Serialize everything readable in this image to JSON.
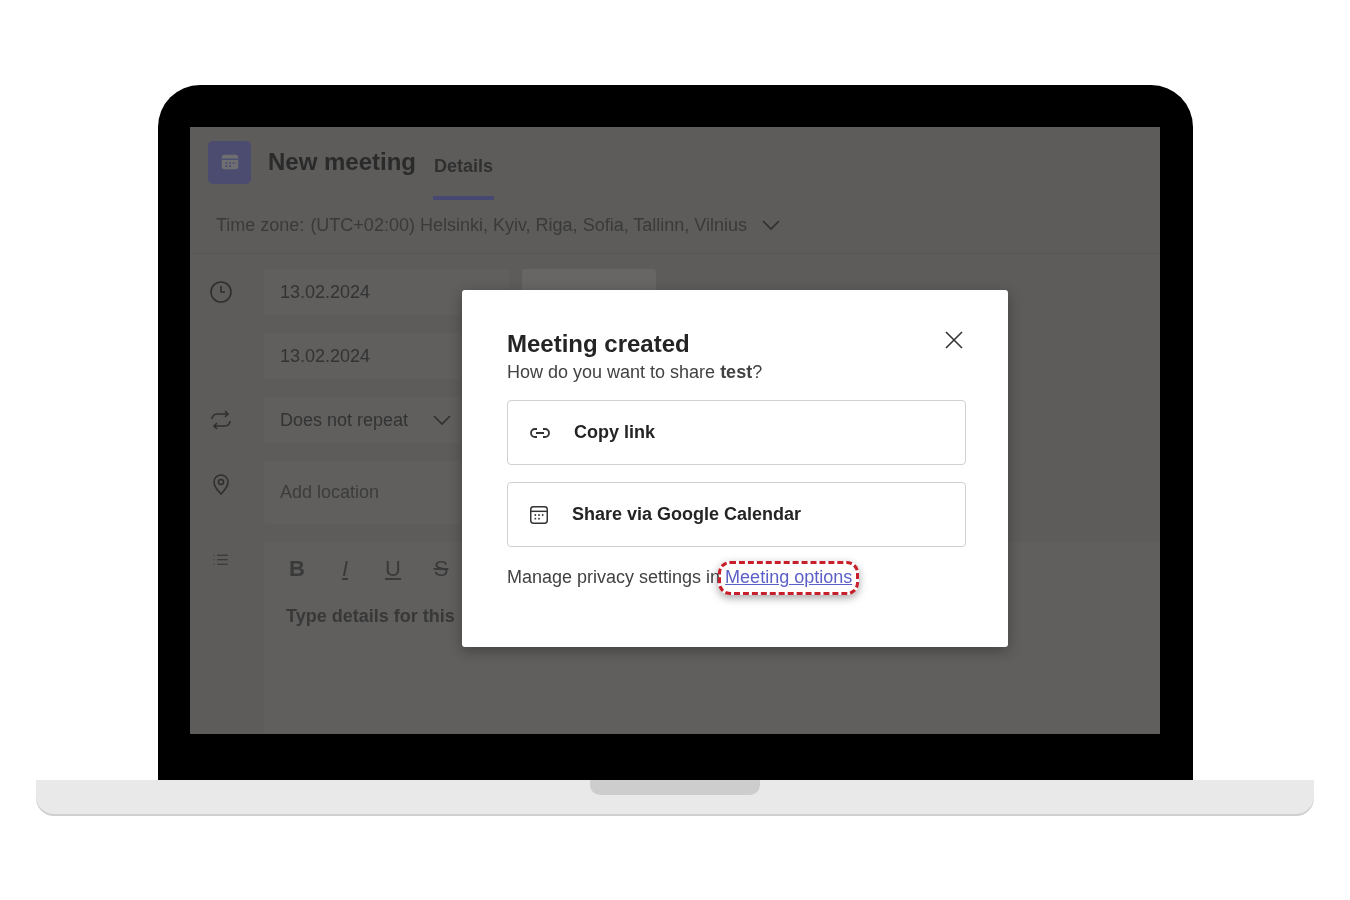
{
  "header": {
    "title": "New meeting",
    "tabs": [
      {
        "label": "Details",
        "selected": true
      }
    ]
  },
  "time_zone": {
    "label": "Time zone:",
    "value": "(UTC+02:00) Helsinki, Kyiv, Riga, Sofia, Tallinn, Vilnius"
  },
  "form": {
    "start_date": "13.02.2024",
    "end_date": "13.02.2024",
    "repeat": "Does not repeat",
    "location_placeholder": "Add location",
    "format_buttons": [
      {
        "label": "B",
        "kind": "bold"
      },
      {
        "label": "I",
        "kind": "italic"
      },
      {
        "label": "U",
        "kind": "underline"
      },
      {
        "label": "S",
        "kind": "strike"
      }
    ],
    "details_placeholder": "Type details for this"
  },
  "dialog": {
    "title": "Meeting created",
    "subtitle": "How do you want to share **test**?",
    "actions": [
      {
        "label": "Copy link",
        "kind": "link"
      },
      {
        "label": "Share via Google Calendar",
        "kind": "calendar"
      }
    ],
    "footer_text": "Manage privacy settings in",
    "footer_link": {
      "label": "Meeting options",
      "highlighted": true
    }
  }
}
